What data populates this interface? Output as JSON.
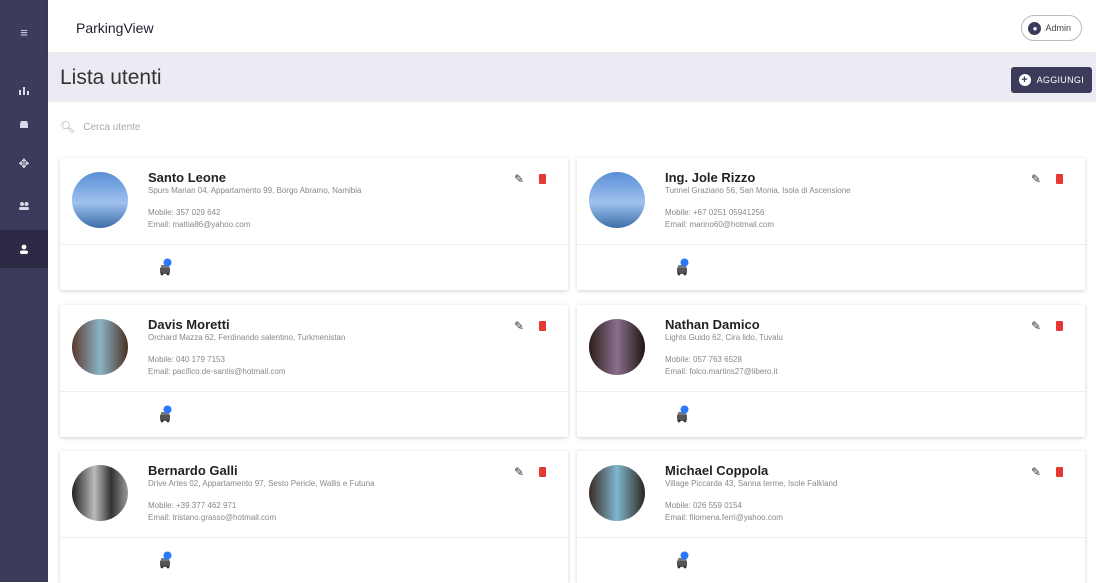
{
  "app": {
    "title": "ParkingView"
  },
  "user": {
    "name": "Admin"
  },
  "page": {
    "title": "Lista utenti",
    "add_label": "AGGIUNGI"
  },
  "search": {
    "placeholder": "Cerca utente",
    "value": ""
  },
  "rail": {
    "items": [
      {
        "icon": "menu-icon",
        "glyph": "≡"
      },
      {
        "icon": "chart-icon",
        "glyph": "ıl"
      },
      {
        "icon": "car-icon",
        "glyph": "▬"
      },
      {
        "icon": "move-icon",
        "glyph": "✥"
      },
      {
        "icon": "people-icon",
        "glyph": "⚇"
      },
      {
        "icon": "person-icon",
        "glyph": "●"
      }
    ],
    "active_index": 5
  },
  "users": [
    {
      "name": "Santo Leone",
      "address": "Spurs Marian 04, Appartamento 99, Borgo Abramo, Namibia",
      "mobile": "Mobile: 357 029 642",
      "email": "Email: mattia86@yahoo.com"
    },
    {
      "name": "Ing. Jole Rizzo",
      "address": "Tunnel Graziano 56, San Monia, Isola di Ascensione",
      "mobile": "Mobile: +67 0251 05941256",
      "email": "Email: marino60@hotmail.com"
    },
    {
      "name": "Davis Moretti",
      "address": "Orchard Mazza 62, Ferdinando salentino, Turkmenistan",
      "mobile": "Mobile: 040 179 7153",
      "email": "Email: pacifico.de-santis@hotmail.com"
    },
    {
      "name": "Nathan Damico",
      "address": "Lights Guido 62, Cira lido, Tuvalu",
      "mobile": "Mobile: 057 763 6528",
      "email": "Email: folco.martins27@libero.it"
    },
    {
      "name": "Bernardo Galli",
      "address": "Drive Artes 02, Appartamento 97, Sesto Pericle, Wallis e Futuna",
      "mobile": "Mobile: +39 377 462 971",
      "email": "Email: tristano.grasso@hotmail.com"
    },
    {
      "name": "Michael Coppola",
      "address": "Village Piccarda 43, Sanna terme, Isole Falkland",
      "mobile": "Mobile: 026 559 0154",
      "email": "Email: filomena.ferri@yahoo.com"
    }
  ],
  "colors": {
    "primary": "#3d3b5b",
    "delete": "#e53935",
    "badge": "#2979ff"
  }
}
